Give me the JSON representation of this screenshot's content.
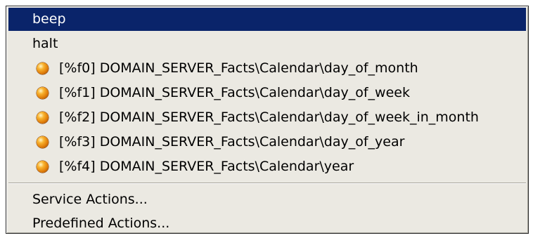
{
  "menu": {
    "commands": [
      {
        "label": "beep",
        "selected": true
      },
      {
        "label": "halt",
        "selected": false
      }
    ],
    "facts": [
      {
        "label": "[%f0] DOMAIN_SERVER_Facts\\Calendar\\day_of_month",
        "icon": "orange-bullet-icon"
      },
      {
        "label": "[%f1] DOMAIN_SERVER_Facts\\Calendar\\day_of_week",
        "icon": "orange-bullet-icon"
      },
      {
        "label": "[%f2] DOMAIN_SERVER_Facts\\Calendar\\day_of_week_in_month",
        "icon": "orange-bullet-icon"
      },
      {
        "label": "[%f3] DOMAIN_SERVER_Facts\\Calendar\\day_of_year",
        "icon": "orange-bullet-icon"
      },
      {
        "label": "[%f4] DOMAIN_SERVER_Facts\\Calendar\\year",
        "icon": "orange-bullet-icon"
      }
    ],
    "actions": [
      {
        "label": "Service Actions..."
      },
      {
        "label": "Predefined Actions..."
      }
    ]
  },
  "colors": {
    "menu_background": "#ebe9e2",
    "selection_background": "#0a246a",
    "selection_text": "#ffffff",
    "bullet": "#e07d0a"
  }
}
